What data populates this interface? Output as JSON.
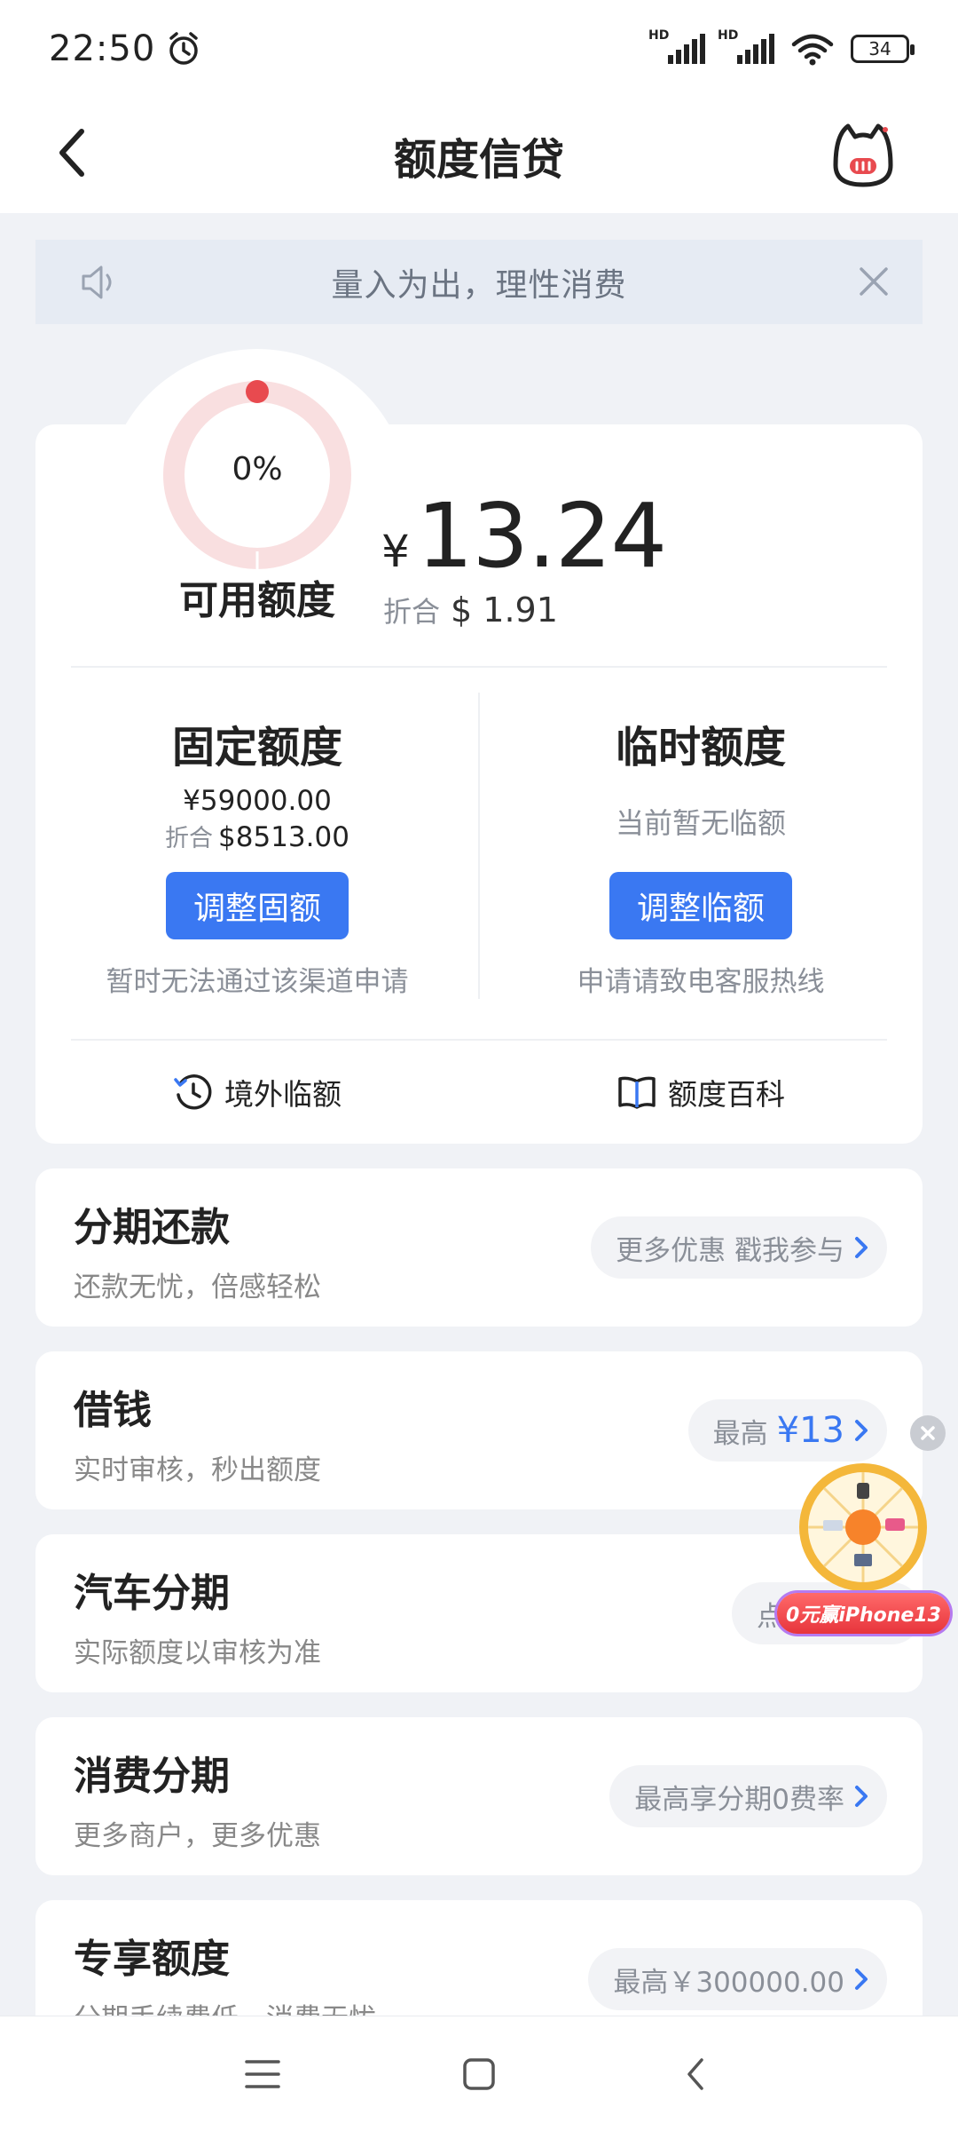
{
  "status_bar": {
    "time": "22:50",
    "battery": "34",
    "signal_label": "HD"
  },
  "header": {
    "title": "额度信贷"
  },
  "notice": {
    "text": "量入为出，理性消费"
  },
  "credit": {
    "progress_text": "0%",
    "progress_value": 0,
    "available_label": "可用额度",
    "currency_symbol": "¥",
    "amount": "13.24",
    "equiv_label": "折合",
    "equiv_value": "$ 1.91",
    "fixed": {
      "title": "固定额度",
      "amount": "¥59000.00",
      "equiv_label": "折合",
      "equiv_value": "$8513.00",
      "button": "调整固额",
      "note": "暂时无法通过该渠道申请"
    },
    "temporary": {
      "title": "临时额度",
      "status": "当前暂无临额",
      "button": "调整临额",
      "note": "申请请致电客服热线"
    },
    "links": {
      "overseas": "境外临额",
      "wiki": "额度百科"
    }
  },
  "services": [
    {
      "title": "分期还款",
      "subtitle": "还款无忧，倍感轻松",
      "pill": "更多优惠 戳我参与",
      "pill_highlight": ""
    },
    {
      "title": "借钱",
      "subtitle": "实时审核，秒出额度",
      "pill": "最高",
      "pill_highlight": "¥13"
    },
    {
      "title": "汽车分期",
      "subtitle": "实际额度以审核为准",
      "pill": "点击",
      "pill_highlight": ""
    },
    {
      "title": "消费分期",
      "subtitle": "更多商户，更多优惠",
      "pill": "最高享分期0费率",
      "pill_highlight": ""
    },
    {
      "title": "专享额度",
      "subtitle": "分期手续费低，消费无忧",
      "pill": "最高￥300000.00",
      "pill_highlight": ""
    }
  ],
  "promo": {
    "label": "0元赢iPhone13"
  },
  "colors": {
    "accent": "#3a78f2",
    "ring": "#f9dfe0",
    "ring_dot": "#e84a4f"
  }
}
